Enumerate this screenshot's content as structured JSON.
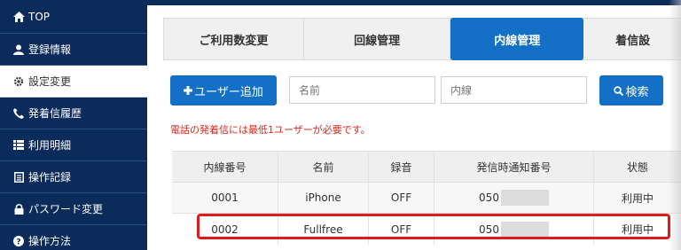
{
  "sidebar": {
    "items": [
      {
        "label": "TOP"
      },
      {
        "label": "登録情報"
      },
      {
        "label": "設定変更"
      },
      {
        "label": "発着信履歴"
      },
      {
        "label": "利用明細"
      },
      {
        "label": "操作記録"
      },
      {
        "label": "パスワード変更"
      },
      {
        "label": "操作方法"
      }
    ]
  },
  "tabs": [
    {
      "label": "ご利用数変更"
    },
    {
      "label": "回線管理"
    },
    {
      "label": "内線管理"
    },
    {
      "label": "着信設"
    }
  ],
  "toolbar": {
    "add_label": "ユーザー追加",
    "name_placeholder": "名前",
    "extension_placeholder": "内線",
    "search_label": "検索"
  },
  "notice": "電話の発着信には最低1ユーザーが必要です。",
  "table": {
    "headers": [
      "内線番号",
      "名前",
      "録音",
      "発信時通知番号",
      "状態"
    ],
    "rows": [
      {
        "ext": "0001",
        "name": "iPhone",
        "rec": "OFF",
        "caller": "050",
        "status": "利用中"
      },
      {
        "ext": "0002",
        "name": "Fullfree",
        "rec": "OFF",
        "caller": "050",
        "status": "利用中"
      }
    ]
  },
  "colors": {
    "sidebar": "#0b2b5a",
    "accent": "#1470c7",
    "warning": "#e0261a",
    "highlight": "#e0191a"
  }
}
